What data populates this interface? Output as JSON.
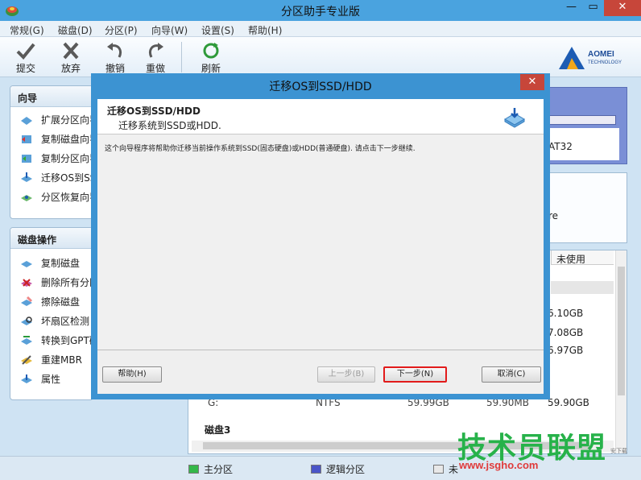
{
  "window": {
    "title": "分区助手专业版",
    "minimize_glyph": "—",
    "restore_glyph": "▭",
    "close_glyph": "✕"
  },
  "menu": [
    "常规(G)",
    "磁盘(D)",
    "分区(P)",
    "向导(W)",
    "设置(S)",
    "帮助(H)"
  ],
  "toolbar": {
    "commit": "提交",
    "discard": "放弃",
    "undo": "撤销",
    "redo": "重做",
    "refresh": "刷新"
  },
  "brand": {
    "name": "AOMEI",
    "sub": "TECHNOLOGY",
    "color": "#1d4c97"
  },
  "wizard_panel": {
    "title": "向导",
    "items": [
      "扩展分区向导",
      "复制磁盘向导",
      "复制分区向导",
      "迁移OS到SSD",
      "分区恢复向导"
    ]
  },
  "disk_panel": {
    "title": "磁盘操作",
    "items": [
      "复制磁盘",
      "删除所有分区",
      "擦除磁盘",
      "坏扇区检测",
      "转换到GPT磁盘",
      "重建MBR",
      "属性"
    ]
  },
  "background": {
    "fs_fragment": "AT32",
    "re_fragment": "re",
    "unused_col": "未使用",
    "sizes": [
      "6.10GB",
      "7.08GB",
      "6.97GB"
    ],
    "row_g": {
      "letter": "G:",
      "fs": "NTFS",
      "total": "59.99GB",
      "used": "59.90MB",
      "free": "59.90GB"
    },
    "disk3": "磁盘3"
  },
  "dialog": {
    "title": "迁移OS到SSD/HDD",
    "heading": "迁移OS到SSD/HDD",
    "subheading": "迁移系统到SSD或HDD.",
    "description": "这个向导程序将帮助你迁移当前操作系统到SSD(固态硬盘)或HDD(普通硬盘). 请点击下一步继续.",
    "close_glyph": "✕",
    "help_button": "帮助(H)",
    "back_button": "上一步(B)",
    "next_button": "下一步(N)",
    "cancel_button": "取消(C)"
  },
  "watermark": {
    "line1": "技术员联盟",
    "line2": "www.jsgho.com",
    "corner": "安下载"
  },
  "statusbar": {
    "primary": "主分区",
    "logical": "逻辑分区",
    "unallocated": "未",
    "primary_color": "#34b84a",
    "logical_color": "#4a55c8",
    "unallocated_color": "#e8e8e8"
  },
  "colors": {
    "titlebar": "#4aa3df",
    "close": "#c7463a",
    "accent_red": "#e21b1b"
  }
}
